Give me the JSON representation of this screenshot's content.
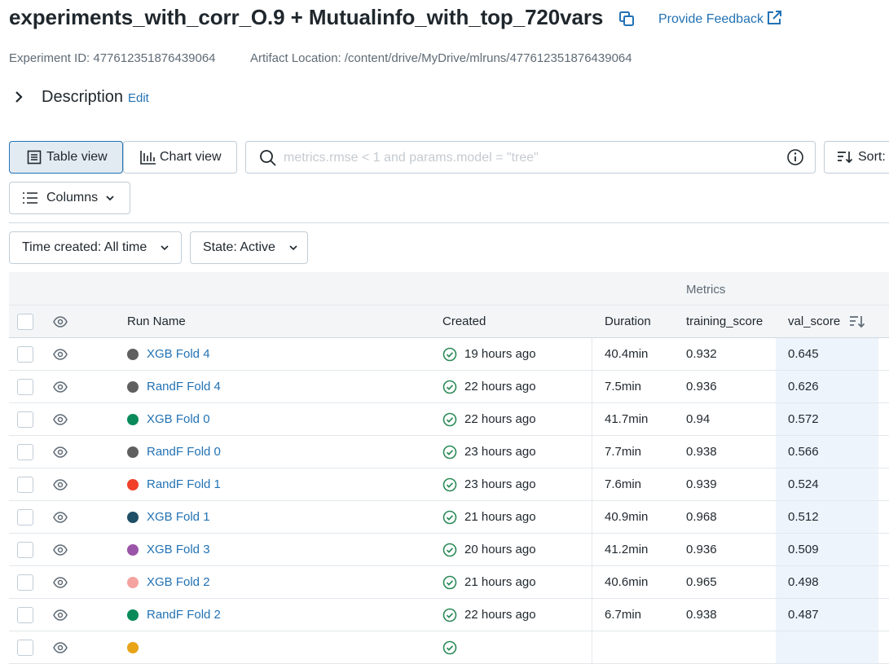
{
  "header": {
    "title": "experiments_with_corr_O.9 + Mutualinfo_with_top_720vars",
    "feedback_label": "Provide Feedback",
    "experiment_id_text": "Experiment ID: 477612351876439064",
    "artifact_text": "Artifact Location: /content/drive/MyDrive/mlruns/477612351876439064"
  },
  "description": {
    "label": "Description",
    "edit_label": "Edit"
  },
  "toolbar": {
    "table_view_label": "Table view",
    "chart_view_label": "Chart view",
    "search_placeholder": "metrics.rmse < 1 and params.model = \"tree\"",
    "sort_label": "Sort:",
    "columns_label": "Columns"
  },
  "filters": {
    "time_created_label": "Time created: All time",
    "state_label": "State: Active"
  },
  "table": {
    "group_header": "Metrics",
    "columns": {
      "run_name": "Run Name",
      "created": "Created",
      "duration": "Duration",
      "training_score": "training_score",
      "val_score": "val_score"
    },
    "rows": [
      {
        "name": "XGB Fold 4",
        "color": "#5f5f5f",
        "created": "19 hours ago",
        "duration": "40.4min",
        "training_score": "0.932",
        "val_score": "0.645"
      },
      {
        "name": "RandF Fold 4",
        "color": "#5f5f5f",
        "created": "22 hours ago",
        "duration": "7.5min",
        "training_score": "0.936",
        "val_score": "0.626"
      },
      {
        "name": "XGB Fold 0",
        "color": "#0a8a5a",
        "created": "22 hours ago",
        "duration": "41.7min",
        "training_score": "0.94",
        "val_score": "0.572"
      },
      {
        "name": "RandF Fold 0",
        "color": "#5f5f5f",
        "created": "23 hours ago",
        "duration": "7.7min",
        "training_score": "0.938",
        "val_score": "0.566"
      },
      {
        "name": "RandF Fold 1",
        "color": "#f0402a",
        "created": "23 hours ago",
        "duration": "7.6min",
        "training_score": "0.939",
        "val_score": "0.524"
      },
      {
        "name": "XGB Fold 1",
        "color": "#1f4f66",
        "created": "21 hours ago",
        "duration": "40.9min",
        "training_score": "0.968",
        "val_score": "0.512"
      },
      {
        "name": "XGB Fold 3",
        "color": "#9b55a8",
        "created": "20 hours ago",
        "duration": "41.2min",
        "training_score": "0.936",
        "val_score": "0.509"
      },
      {
        "name": "XGB Fold 2",
        "color": "#f5a3a0",
        "created": "21 hours ago",
        "duration": "40.6min",
        "training_score": "0.965",
        "val_score": "0.498"
      },
      {
        "name": "RandF Fold 2",
        "color": "#0a8a5a",
        "created": "22 hours ago",
        "duration": "6.7min",
        "training_score": "0.938",
        "val_score": "0.487"
      }
    ],
    "partial_row": {
      "color": "#e8a317"
    }
  },
  "colors": {
    "link": "#2272b4",
    "success": "#2b8a57",
    "accent_bg": "#e3ebf2"
  }
}
